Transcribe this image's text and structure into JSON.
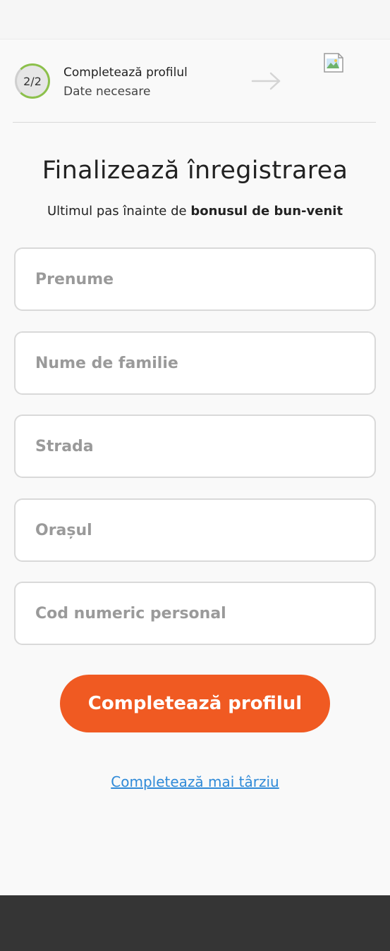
{
  "step": {
    "counter": "2/2",
    "title": "Completează profilul",
    "subtitle": "Date necesare",
    "progress_fraction": 1.0,
    "arrow_icon": "arrow-right-icon",
    "image_icon": "broken-image-icon"
  },
  "heading": {
    "title": "Finalizează înregistrarea",
    "subtitle_prefix": "Ultimul pas înainte de ",
    "subtitle_bold": "bonusul de bun-venit"
  },
  "form": {
    "first_name": {
      "placeholder": "Prenume",
      "value": ""
    },
    "last_name": {
      "placeholder": "Nume de familie",
      "value": ""
    },
    "street": {
      "placeholder": "Strada",
      "value": ""
    },
    "city": {
      "placeholder": "Orașul",
      "value": ""
    },
    "cnp": {
      "placeholder": "Cod numeric personal",
      "value": ""
    }
  },
  "actions": {
    "submit_label": "Completează profilul",
    "later_label": "Completează mai târziu"
  },
  "colors": {
    "accent": "#f05a22",
    "progress": "#8cc04b",
    "link": "#2f8ad8",
    "bottom_bar": "#353535"
  }
}
